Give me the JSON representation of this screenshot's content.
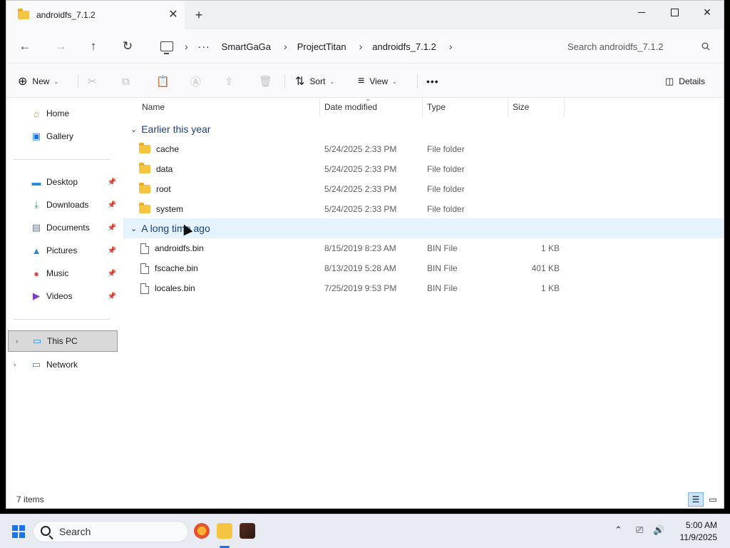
{
  "window": {
    "tab_title": "androidfs_7.1.2",
    "tab_close": "✕",
    "new_tab": "+"
  },
  "nav": {
    "back": "←",
    "forward": "→",
    "up": "↑",
    "refresh": "↻",
    "more": "···",
    "breadcrumb": [
      "SmartGaGa",
      "ProjectTitan",
      "androidfs_7.1.2"
    ],
    "search_placeholder": "Search androidfs_7.1.2"
  },
  "toolbar": {
    "new_label": "New",
    "sort_label": "Sort",
    "view_label": "View",
    "more_label": "•••",
    "details_label": "Details"
  },
  "sidebar": {
    "items": [
      {
        "label": "Home",
        "icon": "home-icon"
      },
      {
        "label": "Gallery",
        "icon": "gallery-icon"
      },
      {
        "label": "Desktop",
        "icon": "desktop-icon",
        "pinned": true
      },
      {
        "label": "Downloads",
        "icon": "downloads-icon",
        "pinned": true
      },
      {
        "label": "Documents",
        "icon": "documents-icon",
        "pinned": true
      },
      {
        "label": "Pictures",
        "icon": "pictures-icon",
        "pinned": true
      },
      {
        "label": "Music",
        "icon": "music-icon",
        "pinned": true
      },
      {
        "label": "Videos",
        "icon": "videos-icon",
        "pinned": true
      },
      {
        "label": "This PC",
        "icon": "pc-icon",
        "selected": true
      },
      {
        "label": "Network",
        "icon": "network-icon"
      }
    ]
  },
  "columns": {
    "name": "Name",
    "date": "Date modified",
    "type": "Type",
    "size": "Size"
  },
  "groups": [
    {
      "title": "Earlier this year",
      "rows": [
        {
          "name": "cache",
          "date": "5/24/2025 2:33 PM",
          "type": "File folder",
          "size": ""
        },
        {
          "name": "data",
          "date": "5/24/2025 2:33 PM",
          "type": "File folder",
          "size": ""
        },
        {
          "name": "root",
          "date": "5/24/2025 2:33 PM",
          "type": "File folder",
          "size": ""
        },
        {
          "name": "system",
          "date": "5/24/2025 2:33 PM",
          "type": "File folder",
          "size": ""
        }
      ]
    },
    {
      "title": "A long time ago",
      "rows": [
        {
          "name": "androidfs.bin",
          "date": "8/15/2019 8:23 AM",
          "type": "BIN File",
          "size": "1 KB"
        },
        {
          "name": "fscache.bin",
          "date": "8/13/2019 5:28 AM",
          "type": "BIN File",
          "size": "401 KB"
        },
        {
          "name": "locales.bin",
          "date": "7/25/2019 9:53 PM",
          "type": "BIN File",
          "size": "1 KB"
        }
      ]
    }
  ],
  "status": {
    "item_count": "7 items"
  },
  "taskbar": {
    "search_label": "Search",
    "time": "5:00 AM",
    "date": "11/9/2025"
  },
  "colors": {
    "accent": "#1a73e8",
    "group_header": "#1c3f82",
    "folder": "#f5c542",
    "hover_row": "#e5f3ff"
  }
}
